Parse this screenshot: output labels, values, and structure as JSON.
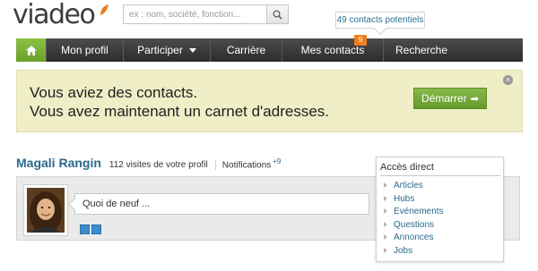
{
  "brand": {
    "logo_text": "viadeo",
    "accent_orange": "#f07d1e",
    "accent_green": "#7ab33b",
    "link_blue": "#2a6a8e"
  },
  "search": {
    "placeholder": "ex : nom, société, fonction...",
    "button_icon": "search-icon"
  },
  "contacts_hint": {
    "label": "49 contacts potentiels"
  },
  "nav": {
    "home_icon": "home-icon",
    "items": [
      {
        "label": "Mon profil"
      },
      {
        "label": "Participer",
        "has_dropdown": true
      },
      {
        "label": "Carrière"
      },
      {
        "label": "Mes contacts",
        "badge": "9"
      },
      {
        "label": "Recherche"
      }
    ]
  },
  "banner": {
    "line1": "Vous aviez des contacts.",
    "line2": "Vous avez maintenant un carnet d'adresses.",
    "button_label": "Démarrer",
    "close_icon": "close-icon"
  },
  "profile": {
    "name": "Magali Rangin",
    "visits": "112 visites de votre profil",
    "notifications_label": "Notifications",
    "notifications_count": "+9"
  },
  "status": {
    "placeholder": "Quoi de neuf ...",
    "share_icons": [
      "twitter-icon",
      "linkedin-icon"
    ]
  },
  "quick_access": {
    "title": "Accès direct",
    "items": [
      {
        "label": "Articles"
      },
      {
        "label": "Hubs"
      },
      {
        "label": "Evénements"
      },
      {
        "label": "Questions"
      },
      {
        "label": "Annonces"
      },
      {
        "label": "Jobs"
      }
    ]
  }
}
